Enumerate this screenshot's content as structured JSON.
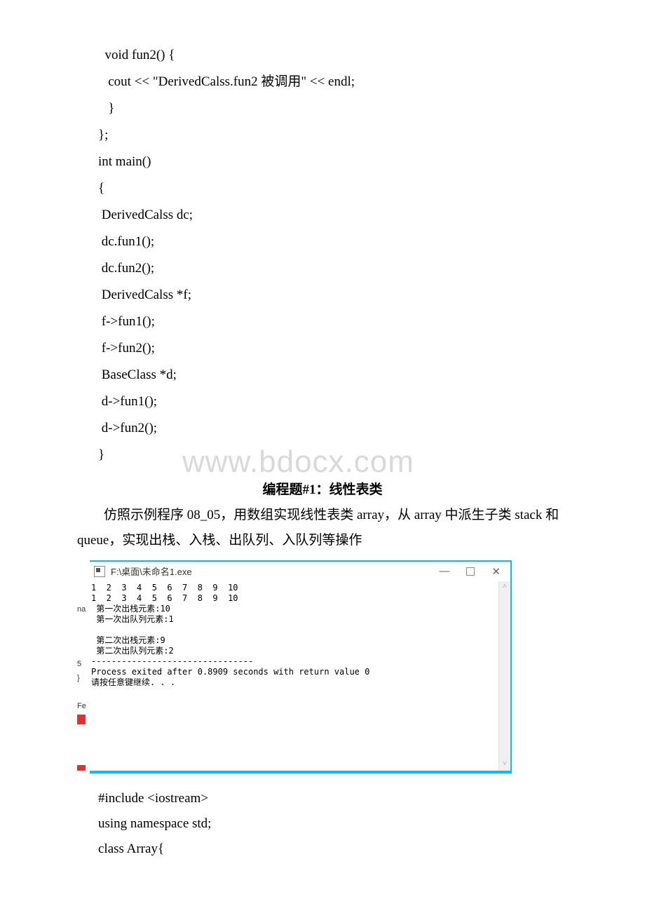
{
  "code": {
    "l1": "  void fun2() {",
    "l2": "   cout << \"DerivedCalss.fun2 被调用\" << endl;",
    "l3": "   }",
    "l4": "};",
    "l5": "int main()",
    "l6": "{",
    "l7": " DerivedCalss dc;",
    "l8": " dc.fun1();",
    "l9": " dc.fun2();",
    "l10": " DerivedCalss *f;",
    "l11": " f->fun1();",
    "l12": " f->fun2();",
    "l13": " BaseClass *d;",
    "l14": " d->fun1();",
    "l15": " d->fun2();",
    "l16": "}"
  },
  "watermark": "www.bdocx.com",
  "heading": "编程题#1：线性表类",
  "desc1": "仿照示例程序 08_05，用数组实现线性表类 array，从 array 中派生子类 stack 和",
  "desc2": "queue，实现出栈、入栈、出队列、入队列等操作",
  "consoleWindow": {
    "title": "F:\\桌面\\未命名1.exe",
    "output": "1  2  3  4  5  6  7  8  9  10\n1  2  3  4  5  6  7  8  9  10\n 第一次出栈元素:10\n 第一次出队列元素:1\n\n 第二次出栈元素:9\n 第二次出队列元素:2\n--------------------------------\nProcess exited after 0.8909 seconds with return value 0\n请按任意键继续. . ."
  },
  "sideLabels": {
    "na": "na",
    "five": "5",
    "brace": "}",
    "fe": "Fe"
  },
  "afterCode": {
    "l1": "#include <iostream>",
    "l2": "using namespace std;",
    "l3": "class Array{"
  }
}
